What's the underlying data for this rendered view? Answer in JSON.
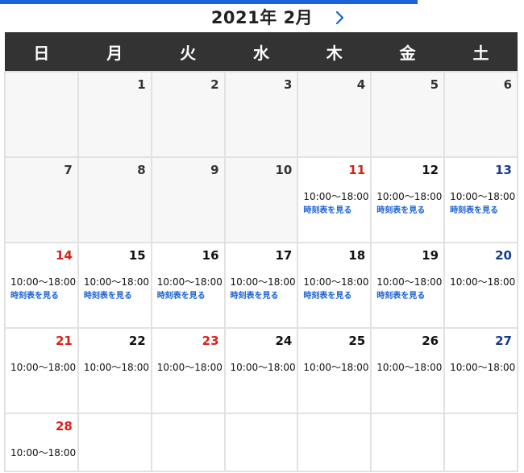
{
  "calendar": {
    "month_title": "2021年 2月",
    "next_icon": "chevron-right-icon",
    "accent_color": "#1b62d6",
    "weekdays": [
      "日",
      "月",
      "火",
      "水",
      "木",
      "金",
      "土"
    ],
    "timetable_label": "時刻表を見る",
    "weeks": [
      [
        {
          "day": "",
          "hours": "",
          "timetable": false,
          "state": "blank"
        },
        {
          "day": "1",
          "hours": "",
          "timetable": false,
          "state": "inactive"
        },
        {
          "day": "2",
          "hours": "",
          "timetable": false,
          "state": "inactive"
        },
        {
          "day": "3",
          "hours": "",
          "timetable": false,
          "state": "inactive"
        },
        {
          "day": "4",
          "hours": "",
          "timetable": false,
          "state": "inactive"
        },
        {
          "day": "5",
          "hours": "",
          "timetable": false,
          "state": "inactive"
        },
        {
          "day": "6",
          "hours": "",
          "timetable": false,
          "state": "inactive"
        }
      ],
      [
        {
          "day": "7",
          "hours": "",
          "timetable": false,
          "state": "inactive"
        },
        {
          "day": "8",
          "hours": "",
          "timetable": false,
          "state": "inactive"
        },
        {
          "day": "9",
          "hours": "",
          "timetable": false,
          "state": "inactive"
        },
        {
          "day": "10",
          "hours": "",
          "timetable": false,
          "state": "inactive"
        },
        {
          "day": "11",
          "hours": "10:00～18:00",
          "timetable": true,
          "state": "open",
          "color": "red"
        },
        {
          "day": "12",
          "hours": "10:00～18:00",
          "timetable": true,
          "state": "open",
          "color": "black"
        },
        {
          "day": "13",
          "hours": "10:00～18:00",
          "timetable": true,
          "state": "open",
          "color": "blue"
        }
      ],
      [
        {
          "day": "14",
          "hours": "10:00～18:00",
          "timetable": true,
          "state": "open",
          "color": "red"
        },
        {
          "day": "15",
          "hours": "10:00～18:00",
          "timetable": true,
          "state": "open",
          "color": "black"
        },
        {
          "day": "16",
          "hours": "10:00～18:00",
          "timetable": true,
          "state": "open",
          "color": "black"
        },
        {
          "day": "17",
          "hours": "10:00～18:00",
          "timetable": true,
          "state": "open",
          "color": "black"
        },
        {
          "day": "18",
          "hours": "10:00～18:00",
          "timetable": true,
          "state": "open",
          "color": "black"
        },
        {
          "day": "19",
          "hours": "10:00～18:00",
          "timetable": true,
          "state": "open",
          "color": "black"
        },
        {
          "day": "20",
          "hours": "10:00～18:00",
          "timetable": false,
          "state": "open",
          "color": "blue"
        }
      ],
      [
        {
          "day": "21",
          "hours": "10:00～18:00",
          "timetable": false,
          "state": "open",
          "color": "red"
        },
        {
          "day": "22",
          "hours": "10:00～18:00",
          "timetable": false,
          "state": "open",
          "color": "black"
        },
        {
          "day": "23",
          "hours": "10:00～18:00",
          "timetable": false,
          "state": "open",
          "color": "red"
        },
        {
          "day": "24",
          "hours": "10:00～18:00",
          "timetable": false,
          "state": "open",
          "color": "black"
        },
        {
          "day": "25",
          "hours": "10:00～18:00",
          "timetable": false,
          "state": "open",
          "color": "black"
        },
        {
          "day": "26",
          "hours": "10:00～18:00",
          "timetable": false,
          "state": "open",
          "color": "black"
        },
        {
          "day": "27",
          "hours": "10:00～18:00",
          "timetable": false,
          "state": "open",
          "color": "blue"
        }
      ],
      [
        {
          "day": "28",
          "hours": "10:00～18:00",
          "timetable": false,
          "state": "open",
          "color": "red"
        },
        {
          "day": "",
          "hours": "",
          "timetable": false,
          "state": "empty"
        },
        {
          "day": "",
          "hours": "",
          "timetable": false,
          "state": "empty"
        },
        {
          "day": "",
          "hours": "",
          "timetable": false,
          "state": "empty"
        },
        {
          "day": "",
          "hours": "",
          "timetable": false,
          "state": "empty"
        },
        {
          "day": "",
          "hours": "",
          "timetable": false,
          "state": "empty"
        },
        {
          "day": "",
          "hours": "",
          "timetable": false,
          "state": "empty"
        }
      ]
    ]
  }
}
